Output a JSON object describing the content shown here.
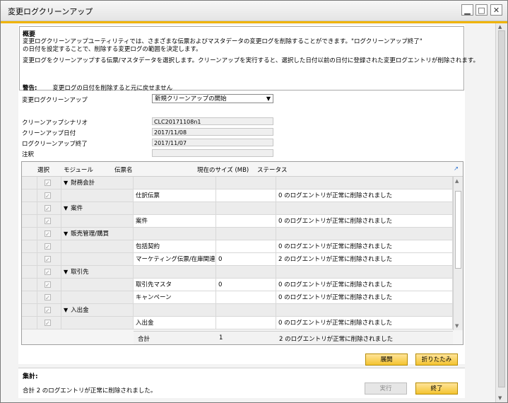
{
  "window": {
    "title": "変更ログクリーンアップ"
  },
  "overview": {
    "title": "概要",
    "line1": "変更ログクリーンアップユーティリティでは、さまざまな伝票およびマスタデータの変更ログを削除することができます。\"ログクリーンアップ終了\"",
    "line2": "の日付を設定することで、削除する変更ログの範囲を決定します。",
    "line3": "変更ログをクリーンアップする伝票/マスタデータを選択します。クリーンアップを実行すると、選択した日付以前の日付に登録された変更ログエントリが削除されます。",
    "warning_label": "警告:",
    "warning_text": "変更ログの日付を削除すると元に戻せません"
  },
  "form": {
    "cleanup_label": "変更ログクリーンアップ",
    "cleanup_value": "新規クリーンアップの開始",
    "scenario_label": "クリーンアップシナリオ",
    "scenario_value": "CLC20171108n1",
    "date_label": "クリーンアップ日付",
    "date_value": "2017/11/08",
    "end_label": "ログクリーンアップ終了",
    "end_value": "2017/11/07",
    "note_label": "注釈",
    "note_value": ""
  },
  "grid": {
    "headers": {
      "select": "選択",
      "module": "モジュール",
      "doc": "伝票名",
      "size": "現在のサイズ (MB)",
      "status": "ステータス"
    },
    "rows": [
      {
        "module": "財務会計",
        "doc": "",
        "size": "",
        "status": ""
      },
      {
        "module": "",
        "doc": "仕訳伝票",
        "size": "",
        "status": "0 のログエントリが正常に削除されました"
      },
      {
        "module": "案件",
        "doc": "",
        "size": "",
        "status": ""
      },
      {
        "module": "",
        "doc": "案件",
        "size": "",
        "status": "0 のログエントリが正常に削除されました"
      },
      {
        "module": "販売管理/購買",
        "doc": "",
        "size": "",
        "status": ""
      },
      {
        "module": "",
        "doc": "包括契約",
        "size": "",
        "status": "0 のログエントリが正常に削除されました"
      },
      {
        "module": "",
        "doc": "マーケティング伝票/在庫関連",
        "size": "0",
        "status": "2 のログエントリが正常に削除されました"
      },
      {
        "module": "取引先",
        "doc": "",
        "size": "",
        "status": ""
      },
      {
        "module": "",
        "doc": "取引先マスタ",
        "size": "0",
        "status": "0 のログエントリが正常に削除されました"
      },
      {
        "module": "",
        "doc": "キャンペーン",
        "size": "",
        "status": "0 のログエントリが正常に削除されました"
      },
      {
        "module": "入出金",
        "doc": "",
        "size": "",
        "status": ""
      },
      {
        "module": "",
        "doc": "入出金",
        "size": "",
        "status": "0 のログエントリが正常に削除されました"
      }
    ],
    "total": {
      "label": "合計",
      "size": "1",
      "status": "2 のログエントリが正常に削除されました"
    }
  },
  "buttons": {
    "expand": "展開",
    "collapse": "折りたたみ",
    "run": "実行",
    "finish": "終了"
  },
  "summary": {
    "title": "集計:",
    "text": "合計 2 のログエントリが正常に削除されました。"
  }
}
